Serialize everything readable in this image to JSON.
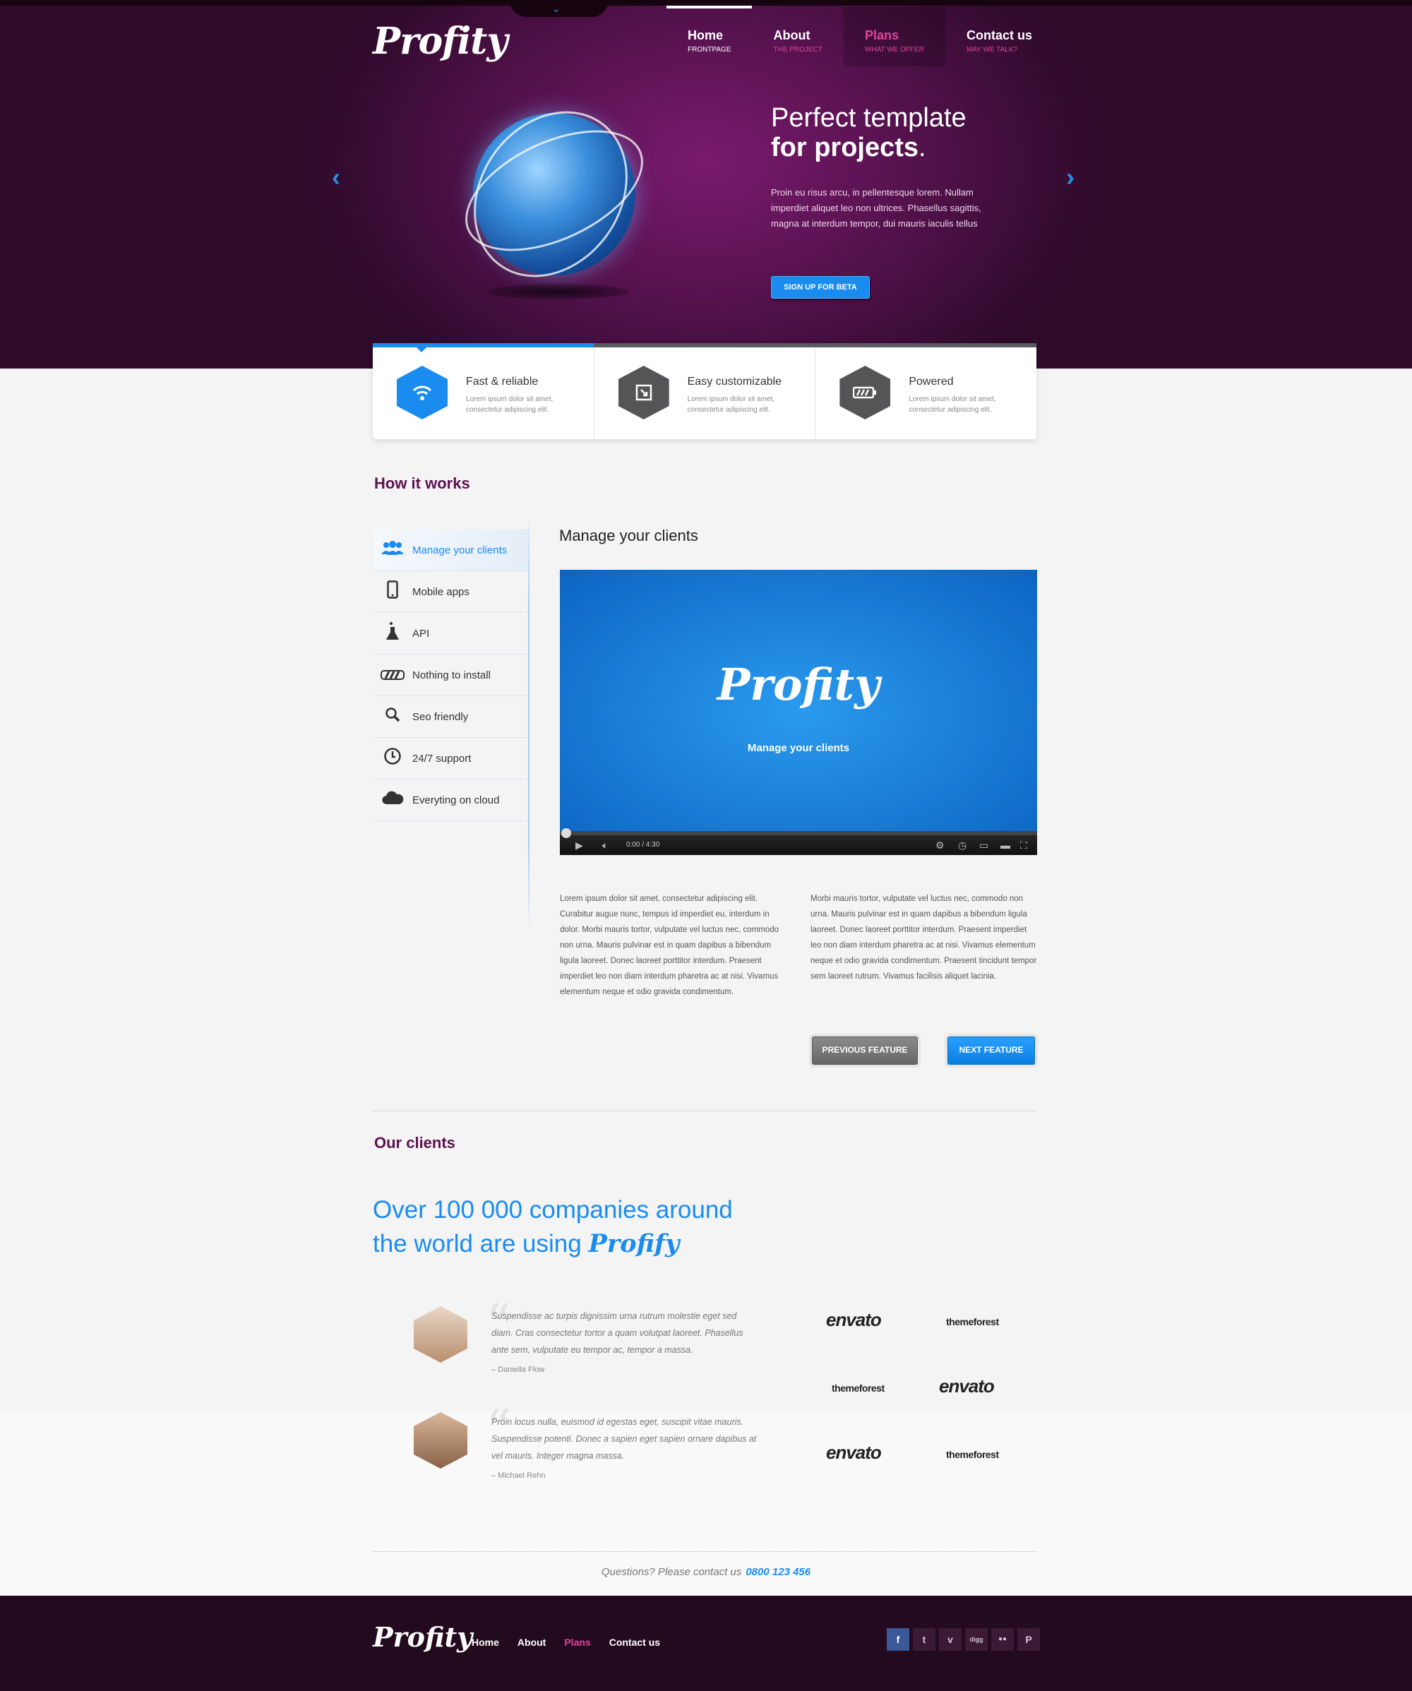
{
  "header": {
    "logo": "Profity",
    "nav": [
      {
        "label": "Home",
        "sub": "FRONTPAGE"
      },
      {
        "label": "About",
        "sub": "THE PROJECT"
      },
      {
        "label": "Plans",
        "sub": "WHAT WE OFFER"
      },
      {
        "label": "Contact us",
        "sub": "MAY WE TALK?"
      }
    ]
  },
  "hero": {
    "title_line1": "Perfect template",
    "title_line2": "for projects",
    "title_dot": ".",
    "text": "Proin eu risus arcu, in pellentesque lorem. Nullam imperdiet aliquet leo non ultrices. Phasellus sagittis, magna at interdum tempor, dui mauris iaculis tellus",
    "cta": "SIGN UP FOR BETA",
    "arrow_left": "‹",
    "arrow_right": "›"
  },
  "features": [
    {
      "title": "Fast & reliable",
      "text": "Lorem ipsum dolor sit amet, consectetur adipiscing elit.",
      "icon": "wifi-icon"
    },
    {
      "title": "Easy customizable",
      "text": "Lorem ipsum dolor sit amet, consectetur adipiscing elit.",
      "icon": "resize-icon"
    },
    {
      "title": "Powered",
      "text": "Lorem ipsum dolor sit amet, consectetur adipiscing elit.",
      "icon": "battery-icon"
    }
  ],
  "how": {
    "heading": "How it works",
    "items": [
      {
        "label": "Manage your clients",
        "icon": "users-icon"
      },
      {
        "label": "Mobile apps",
        "icon": "phone-icon"
      },
      {
        "label": "API",
        "icon": "flask-icon"
      },
      {
        "label": "Nothing to install",
        "icon": "stripes-icon"
      },
      {
        "label": "Seo friendly",
        "icon": "search-icon"
      },
      {
        "label": "24/7 support",
        "icon": "clock-icon"
      },
      {
        "label": "Everyting on cloud",
        "icon": "cloud-icon"
      }
    ],
    "content_title": "Manage your clients",
    "video": {
      "logo": "Profity",
      "subtitle": "Manage your clients",
      "time": "0:00 / 4:30"
    },
    "para1": "Lorem ipsum dolor sit amet, consectetur adipiscing elit. Curabitur augue nunc, tempus id imperdiet eu, interdum in dolor. Morbi mauris tortor, vulputate vel luctus nec, commodo non urna. Mauris pulvinar est in quam dapibus a bibendum ligula laoreet. Donec laoreet porttitor interdum. Praesent imperdiet leo non diam interdum pharetra ac at nisi. Vivamus elementum neque et odio gravida condimentum.",
    "para2": "Morbi mauris tortor, vulputate vel luctus nec, commodo non urna. Mauris pulvinar est in quam dapibus a bibendum ligula laoreet. Donec laoreet porttitor interdum. Praesent imperdiet leo non diam interdum pharetra ac at nisi. Vivamus elementum neque et odio gravida condimentum. Praesent tincidunt tempor sem laoreet rutrum. Vivamus facilisis aliquet lacinia.",
    "prev_label": "PREVIOUS FEATURE",
    "next_label": "NEXT FEATURE"
  },
  "clients": {
    "heading": "Our clients",
    "claim_line1": "Over 100 000 companies around",
    "claim_line2": "the world are using",
    "claim_brand": "Profify",
    "testimonials": [
      {
        "text": "Suspendisse ac turpis dignissim urna rutrum molestie eget sed diam. Cras consectetur tortor a quam volutpat laoreet. Phasellus ante sem, vulputate eu tempor ac, tempor a massa.",
        "author": "– Daniella Flow"
      },
      {
        "text": "Proin locus nulla, euismod id egestas eget, suscipit vitae mauris. Suspendisse potenti. Donec a sapien eget sapien ornare dapibus at vel mauris. Integer magna massa.",
        "author": "– Michael Rehn"
      }
    ],
    "partners": {
      "envato": "envato",
      "themeforest": "themeforest"
    },
    "quote_mark": "“"
  },
  "contact": {
    "text": "Questions? Please contact us",
    "phone": "0800 123 456"
  },
  "footer": {
    "logo": "Profity",
    "nav": [
      "Home",
      "About",
      "Plans",
      "Contact us"
    ],
    "social": [
      {
        "label": "f",
        "icon": "facebook-icon"
      },
      {
        "label": "t",
        "icon": "twitter-icon"
      },
      {
        "label": "v",
        "icon": "vimeo-icon"
      },
      {
        "label": "digg",
        "icon": "digg-icon"
      },
      {
        "label": "●●",
        "icon": "flickr-icon"
      },
      {
        "label": "P",
        "icon": "pinterest-icon"
      }
    ]
  },
  "colors": {
    "accent": "#1a8cf0",
    "heading_purple": "#5e1050",
    "pink": "#e0449a",
    "footer_bg": "#230a1f"
  }
}
